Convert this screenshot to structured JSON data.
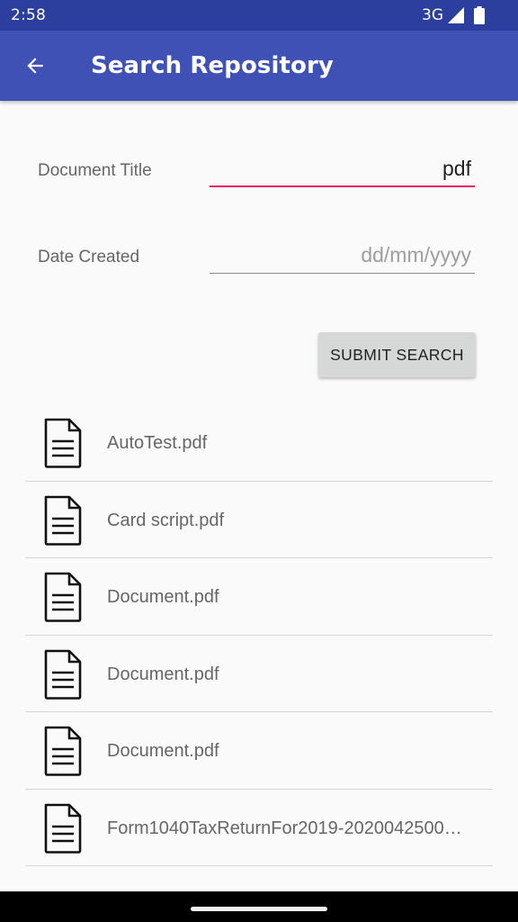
{
  "status_bar": {
    "time": "2:58",
    "network": "3G",
    "icons": [
      "signal-icon",
      "battery-icon"
    ]
  },
  "app_bar": {
    "title": "Search Repository",
    "back_icon": "arrow-back-icon"
  },
  "form": {
    "document_title_label": "Document Title",
    "document_title_value": "pdf",
    "date_created_label": "Date Created",
    "date_created_placeholder": "dd/mm/yyyy",
    "submit_label": "SUBMIT SEARCH"
  },
  "results": [
    {
      "name": "AutoTest.pdf",
      "icon": "document-icon"
    },
    {
      "name": "Card script.pdf",
      "icon": "document-icon"
    },
    {
      "name": "Document.pdf",
      "icon": "document-icon"
    },
    {
      "name": "Document.pdf",
      "icon": "document-icon"
    },
    {
      "name": "Document.pdf",
      "icon": "document-icon"
    },
    {
      "name": "Form1040TaxReturnFor2019-2020042500…",
      "icon": "document-icon"
    }
  ],
  "colors": {
    "status_bar": "#2c3e9e",
    "app_bar": "#3f51b5",
    "accent": "#e91e63",
    "button": "#d6d7d7"
  }
}
